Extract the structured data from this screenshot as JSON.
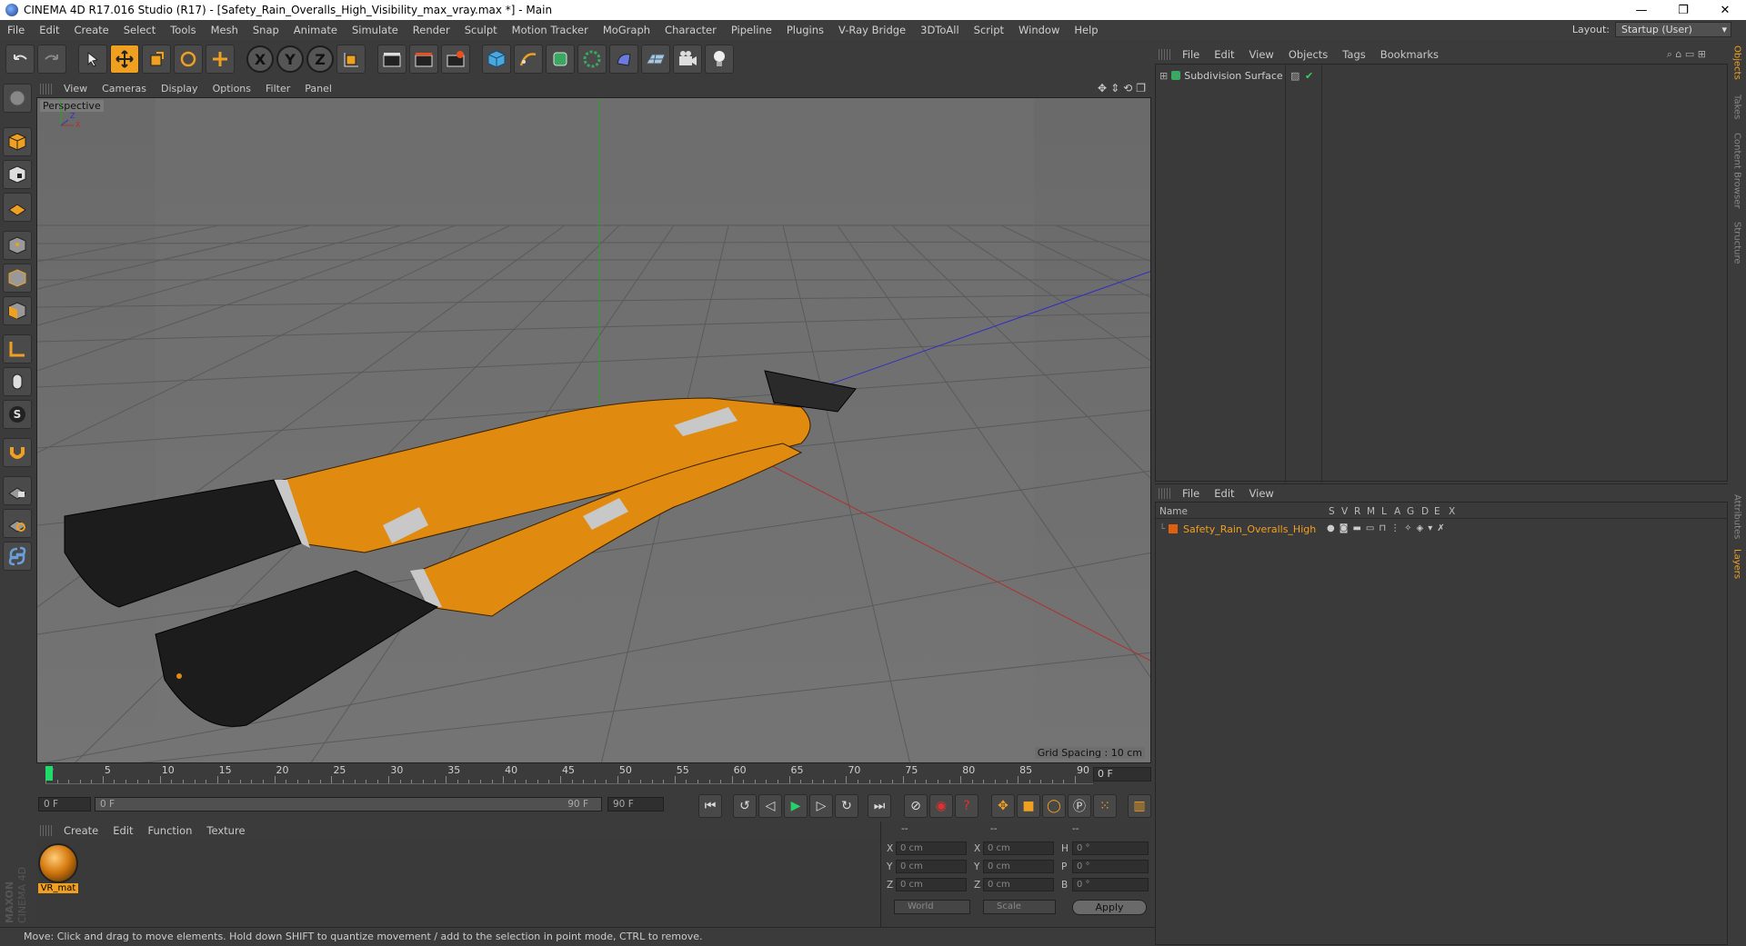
{
  "window": {
    "title": "CINEMA 4D R17.016 Studio (R17) - [Safety_Rain_Overalls_High_Visibility_max_vray.max *] - Main",
    "controls": [
      "—",
      "❐",
      "✕"
    ]
  },
  "menubar": {
    "items": [
      "File",
      "Edit",
      "Create",
      "Select",
      "Tools",
      "Mesh",
      "Snap",
      "Animate",
      "Simulate",
      "Render",
      "Sculpt",
      "Motion Tracker",
      "MoGraph",
      "Character",
      "Pipeline",
      "Plugins",
      "V-Ray Bridge",
      "3DToAll",
      "Script",
      "Window",
      "Help"
    ],
    "layout_label": "Layout:",
    "layout_value": "Startup (User)"
  },
  "toolbar": {
    "xyz": [
      "X",
      "Y",
      "Z"
    ]
  },
  "viewport": {
    "menu": [
      "View",
      "Cameras",
      "Display",
      "Options",
      "Filter",
      "Panel"
    ],
    "label": "Perspective",
    "grid_spacing": "Grid Spacing : 10 cm",
    "axis_labels": [
      "Y",
      "X",
      "Z"
    ]
  },
  "timeline": {
    "ticks": [
      "0",
      "5",
      "10",
      "15",
      "20",
      "25",
      "30",
      "35",
      "40",
      "45",
      "50",
      "55",
      "60",
      "65",
      "70",
      "75",
      "80",
      "85",
      "90"
    ],
    "current_frame": "0 F"
  },
  "transport": {
    "start_field": "0 F",
    "range_start": "0 F",
    "range_end": "90 F",
    "end_field": "90 F"
  },
  "material_manager": {
    "menu": [
      "Create",
      "Edit",
      "Function",
      "Texture"
    ],
    "material_name": "VR_mat"
  },
  "branding": "MAXON CINEMA 4D",
  "coordinates": {
    "headers": [
      "--",
      "--",
      "--"
    ],
    "rows": [
      {
        "a": "X",
        "a_val": "0 cm",
        "b": "X",
        "b_val": "0 cm",
        "c": "H",
        "c_val": "0 °"
      },
      {
        "a": "Y",
        "a_val": "0 cm",
        "b": "Y",
        "b_val": "0 cm",
        "c": "P",
        "c_val": "0 °"
      },
      {
        "a": "Z",
        "a_val": "0 cm",
        "b": "Z",
        "b_val": "0 cm",
        "c": "B",
        "c_val": "0 °"
      }
    ],
    "space": "World",
    "mode": "Scale",
    "apply": "Apply"
  },
  "status": "Move: Click and drag to move elements. Hold down SHIFT to quantize movement / add to the selection in point mode, CTRL to remove.",
  "objects_panel": {
    "menu": [
      "File",
      "Edit",
      "View",
      "Objects",
      "Tags",
      "Bookmarks"
    ],
    "object_name": "Subdivision Surface"
  },
  "layers_panel": {
    "menu": [
      "File",
      "Edit",
      "View"
    ],
    "columns": [
      "Name",
      "S",
      "V",
      "R",
      "M",
      "L",
      "A",
      "G",
      "D",
      "E",
      "X"
    ],
    "layer_name": "Safety_Rain_Overalls_High",
    "layer_color": "#e06010"
  },
  "side_tabs": [
    "Objects",
    "Takes",
    "Content Browser",
    "Structure",
    "Attributes",
    "Layers"
  ],
  "colors": {
    "accent": "#f0a020",
    "viewport_bg": "#6e6e6e",
    "panel_bg": "#3a3a3a"
  }
}
